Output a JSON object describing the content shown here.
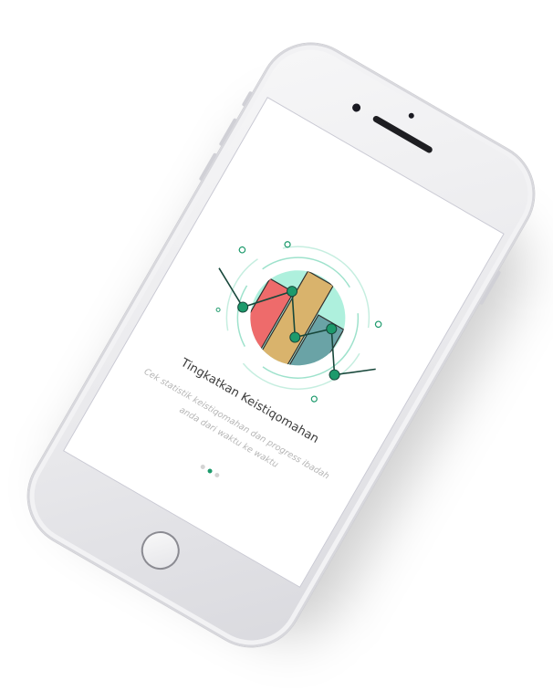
{
  "onboarding": {
    "title": "Tingkatkan Keistiqomahan",
    "subtitle": "Cek statistik keistiqomahan dan progress ibadah anda dari waktu ke waktu",
    "pager": {
      "count": 3,
      "active_index": 1
    }
  },
  "colors": {
    "accent_green": "#1d9a6c",
    "bar_red": "#ee6b6b",
    "bar_tan": "#d9b36c",
    "bar_teal": "#6aa3a6",
    "circle_mint": "#aef0dd"
  },
  "icons": {
    "device": "smartphone",
    "illustration": "statistics-chart-illustration"
  }
}
